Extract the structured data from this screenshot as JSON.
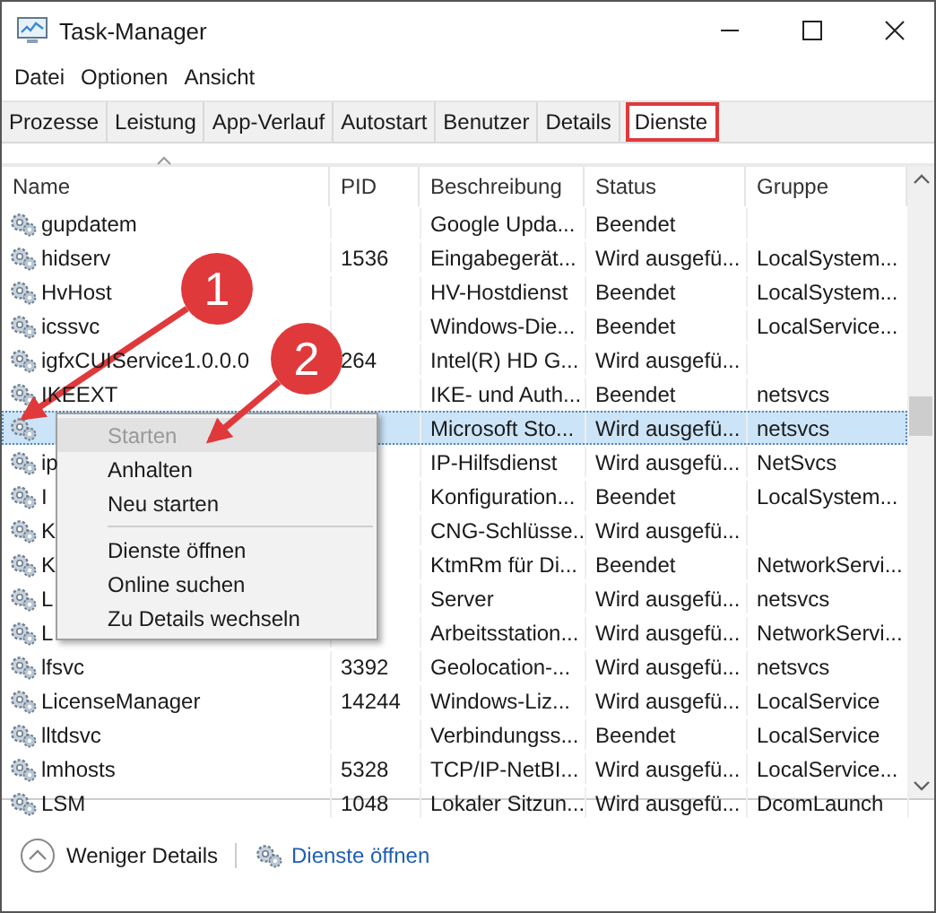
{
  "window": {
    "title": "Task-Manager"
  },
  "menu": [
    "Datei",
    "Optionen",
    "Ansicht"
  ],
  "tabs": [
    {
      "label": "Prozesse",
      "selected": false,
      "highlighted": false
    },
    {
      "label": "Leistung",
      "selected": false,
      "highlighted": false
    },
    {
      "label": "App-Verlauf",
      "selected": false,
      "highlighted": false
    },
    {
      "label": "Autostart",
      "selected": false,
      "highlighted": false
    },
    {
      "label": "Benutzer",
      "selected": false,
      "highlighted": false
    },
    {
      "label": "Details",
      "selected": false,
      "highlighted": false
    },
    {
      "label": "Dienste",
      "selected": true,
      "highlighted": true
    }
  ],
  "table": {
    "columns": [
      "Name",
      "PID",
      "Beschreibung",
      "Status",
      "Gruppe"
    ],
    "rows": [
      {
        "name": "gupdatem",
        "pid": "",
        "description": "Google Upda...",
        "status": "Beendet",
        "group": "",
        "selected": false
      },
      {
        "name": "hidserv",
        "pid": "1536",
        "description": "Eingabegerät...",
        "status": "Wird ausgefü...",
        "group": "LocalSystem...",
        "selected": false
      },
      {
        "name": "HvHost",
        "pid": "",
        "description": "HV-Hostdienst",
        "status": "Beendet",
        "group": "LocalSystem...",
        "selected": false
      },
      {
        "name": "icssvc",
        "pid": "",
        "description": "Windows-Die...",
        "status": "Beendet",
        "group": "LocalService...",
        "selected": false
      },
      {
        "name": "igfxCUIService1.0.0.0",
        "pid": "264",
        "description": "Intel(R) HD G...",
        "status": "Wird ausgefü...",
        "group": "",
        "selected": false
      },
      {
        "name": "IKEEXT",
        "pid": "",
        "description": "IKE- und Auth...",
        "status": "Beendet",
        "group": "netsvcs",
        "selected": false
      },
      {
        "name": "",
        "pid": "",
        "description": "Microsoft Sto...",
        "status": "Wird ausgefü...",
        "group": "netsvcs",
        "selected": true
      },
      {
        "name": "ip",
        "pid": "",
        "description": "IP-Hilfsdienst",
        "status": "Wird ausgefü...",
        "group": "NetSvcs",
        "selected": false
      },
      {
        "name": "I",
        "pid": "",
        "description": "Konfiguration...",
        "status": "Beendet",
        "group": "LocalSystem...",
        "selected": false
      },
      {
        "name": "K",
        "pid": "",
        "description": "CNG-Schlüsse...",
        "status": "Wird ausgefü...",
        "group": "",
        "selected": false
      },
      {
        "name": "K",
        "pid": "",
        "description": "KtmRm für Di...",
        "status": "Beendet",
        "group": "NetworkServi...",
        "selected": false
      },
      {
        "name": "L",
        "pid": "",
        "description": "Server",
        "status": "Wird ausgefü...",
        "group": "netsvcs",
        "selected": false
      },
      {
        "name": "L",
        "pid": "",
        "description": "Arbeitsstation...",
        "status": "Wird ausgefü...",
        "group": "NetworkServi...",
        "selected": false
      },
      {
        "name": "lfsvc",
        "pid": "3392",
        "description": "Geolocation-...",
        "status": "Wird ausgefü...",
        "group": "netsvcs",
        "selected": false
      },
      {
        "name": "LicenseManager",
        "pid": "14244",
        "description": "Windows-Liz...",
        "status": "Wird ausgefü...",
        "group": "LocalService",
        "selected": false
      },
      {
        "name": "lltdsvc",
        "pid": "",
        "description": "Verbindungss...",
        "status": "Beendet",
        "group": "LocalService",
        "selected": false
      },
      {
        "name": "lmhosts",
        "pid": "5328",
        "description": "TCP/IP-NetBI...",
        "status": "Wird ausgefü...",
        "group": "LocalService...",
        "selected": false
      },
      {
        "name": "LSM",
        "pid": "1048",
        "description": "Lokaler Sitzun...",
        "status": "Wird ausgefü...",
        "group": "DcomLaunch",
        "selected": false
      }
    ]
  },
  "context_menu": [
    {
      "kind": "item",
      "label": "Starten",
      "disabled": true,
      "selected": true
    },
    {
      "kind": "item",
      "label": "Anhalten",
      "disabled": false,
      "selected": false
    },
    {
      "kind": "item",
      "label": "Neu starten",
      "disabled": false,
      "selected": false
    },
    {
      "kind": "separator"
    },
    {
      "kind": "item",
      "label": "Dienste öffnen",
      "disabled": false,
      "selected": false
    },
    {
      "kind": "item",
      "label": "Online suchen",
      "disabled": false,
      "selected": false
    },
    {
      "kind": "item",
      "label": "Zu Details wechseln",
      "disabled": false,
      "selected": false
    }
  ],
  "callouts": [
    "1",
    "2"
  ],
  "footer": {
    "toggle": "Weniger Details",
    "link": "Dienste öffnen"
  }
}
